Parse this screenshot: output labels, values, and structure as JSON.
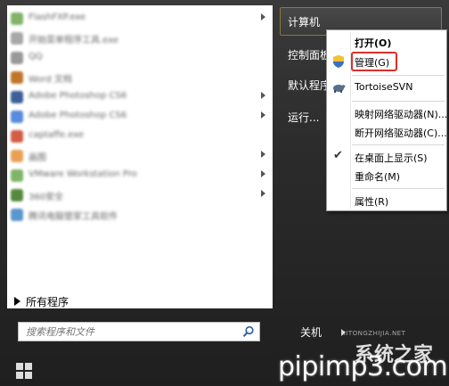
{
  "left_panel": {
    "programs": [
      {
        "label": "FlashFXP.exe",
        "color": "#6aa84f",
        "has_arrow": true
      },
      {
        "label": "开始菜单程序工具.exe",
        "color": "#999999",
        "has_arrow": false
      },
      {
        "label": "QQ",
        "color": "#888888",
        "has_arrow": false
      },
      {
        "label": "Word 文档",
        "color": "#b45f06",
        "has_arrow": false
      },
      {
        "label": "Adobe Photoshop CS6",
        "color": "#1c4587",
        "has_arrow": true
      },
      {
        "label": "Adobe Photoshop CS6",
        "color": "#3c78d8",
        "has_arrow": true
      },
      {
        "label": "captaffe.exe",
        "color": "#cc4125",
        "has_arrow": false
      },
      {
        "label": "画图",
        "color": "#e69138",
        "has_arrow": true
      },
      {
        "label": "VMware Workstation Pro",
        "color": "#6aa84f",
        "has_arrow": true
      },
      {
        "label": "360安全",
        "color": "#38761d",
        "has_arrow": true
      },
      {
        "label": "腾讯电脑管家工具软件",
        "color": "#3d85c6",
        "has_arrow": false
      }
    ],
    "all_programs_label": "所有程序"
  },
  "search": {
    "placeholder": "搜索程序和文件"
  },
  "right_column": {
    "computer": "计算机",
    "control_panel": "控制面板",
    "default_programs": "默认程序",
    "run": "运行..."
  },
  "shutdown_label": "关机",
  "context_menu": {
    "open": "打开(O)",
    "manage": "管理(G)",
    "tortoise": "TortoiseSVN",
    "map_drive": "映射网络驱动器(N)...",
    "disconnect_drive": "断开网络驱动器(C)...",
    "show_desktop": "在桌面上显示(S)",
    "rename": "重命名(M)",
    "properties": "属性(R)"
  },
  "watermark": {
    "url": "pipimp3.com",
    "cn": "系统之家",
    "sub": "XITONGZHIJIA.NET"
  },
  "colors": {
    "highlight_border": "#d9302a",
    "panel_bg": "#ffffff",
    "menu_bg": "#2b2b2b"
  }
}
